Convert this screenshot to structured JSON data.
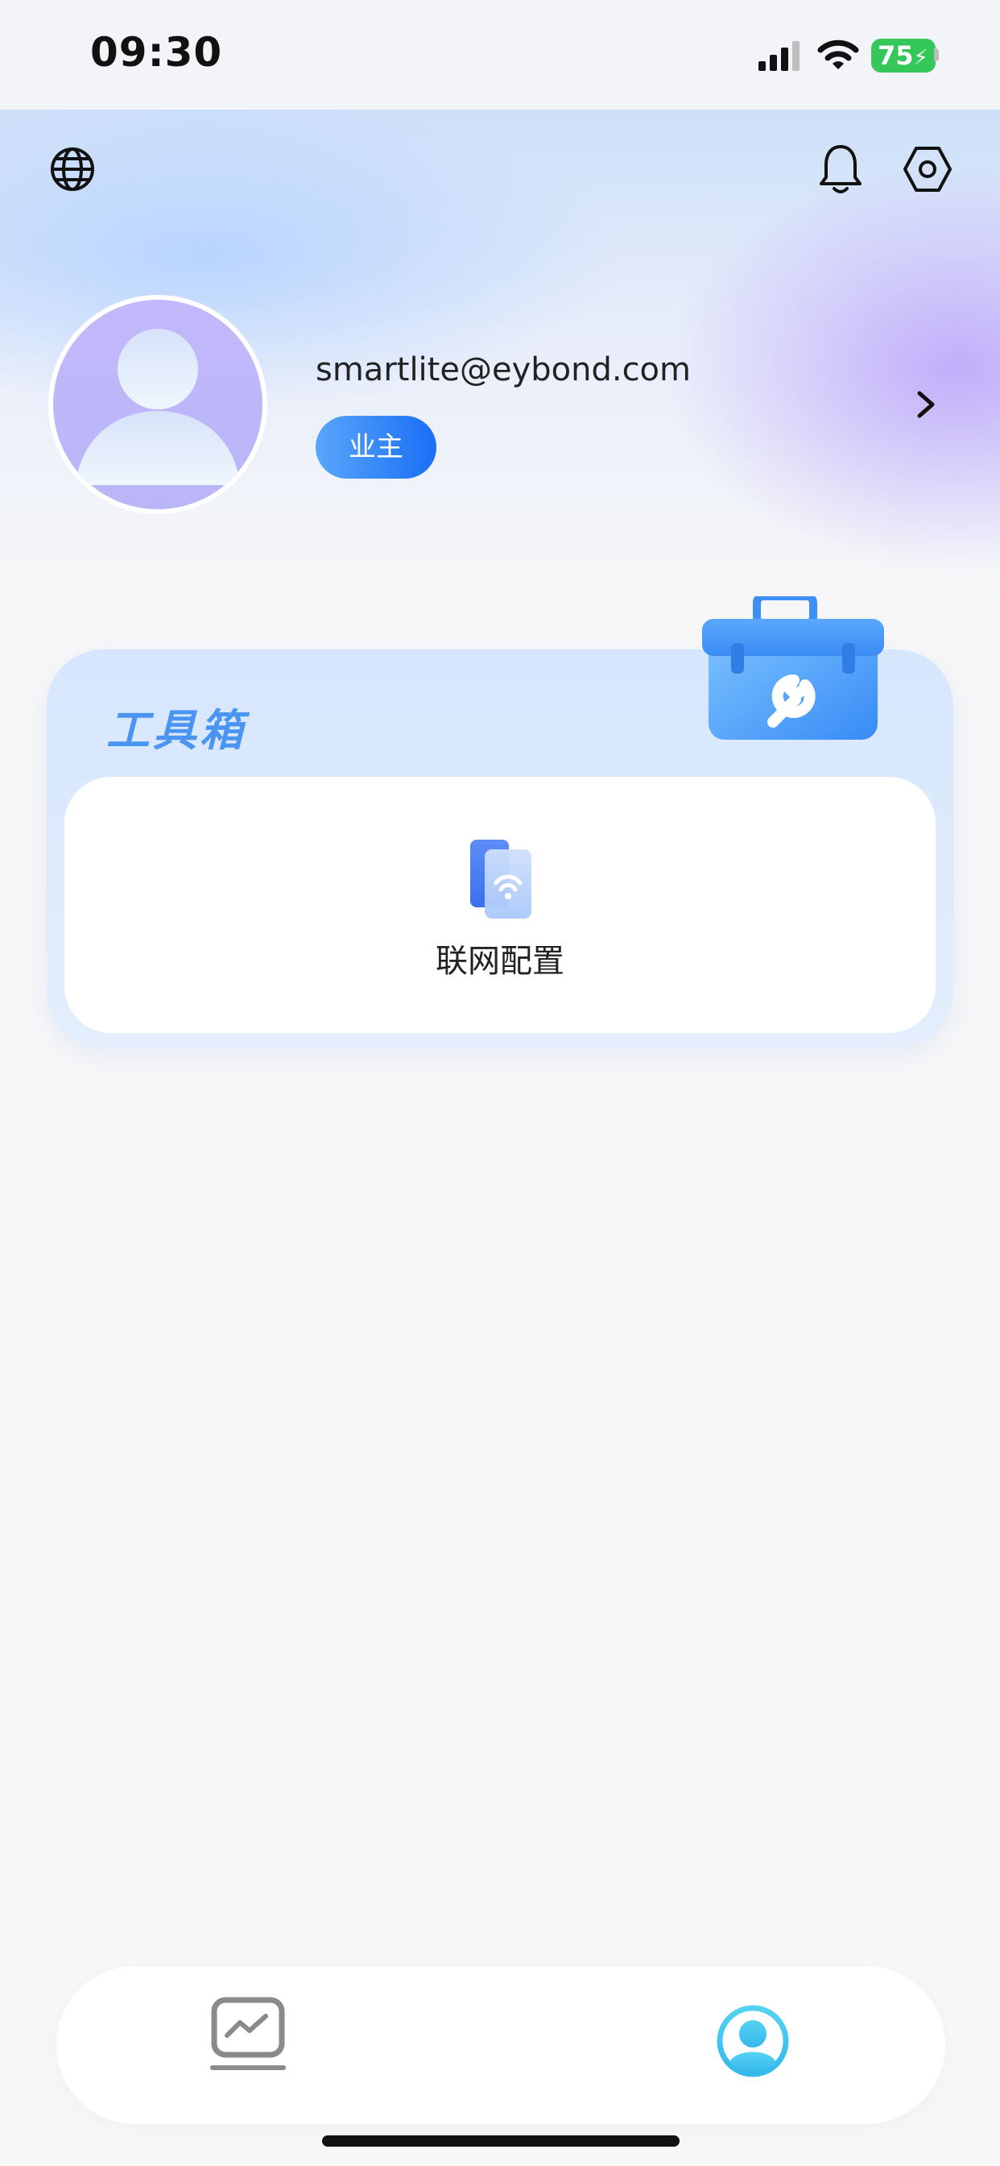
{
  "status_bar": {
    "time": "09:30",
    "battery": "75"
  },
  "header": {
    "icons": {
      "language": "globe-icon",
      "notifications": "bell-icon",
      "settings": "hexagon-settings-icon"
    }
  },
  "profile": {
    "email": "smartlite@eybond.com",
    "role": "业主"
  },
  "toolbox": {
    "title": "工具箱",
    "items": [
      {
        "label": "联网配置",
        "icon": "network-config-icon"
      }
    ]
  },
  "tabbar": {
    "tabs": [
      {
        "icon": "chart-icon",
        "active": false
      },
      {
        "icon": "user-icon",
        "active": true
      }
    ]
  },
  "colors": {
    "accent": "#1a6ef5",
    "active_tab": "#3ec3f0",
    "battery": "#35c759"
  }
}
